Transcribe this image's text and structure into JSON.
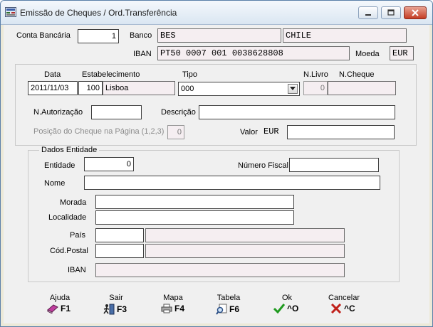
{
  "window": {
    "title": "Emissão de Cheques / Ord.Transferência"
  },
  "header": {
    "conta_label": "Conta Bancária",
    "conta_value": "1",
    "banco_label": "Banco",
    "banco_value": "BES",
    "pais_value": "CHILE",
    "iban_label": "IBAN",
    "iban_value": "PT50 0007  001 0038628808",
    "moeda_label": "Moeda",
    "moeda_value": "EUR"
  },
  "cheque": {
    "data_label": "Data",
    "data_value": "2011/11/03",
    "estab_label": "Estabelecimento",
    "estab_code": "100",
    "estab_name": "Lisboa",
    "tipo_label": "Tipo",
    "tipo_value": "000",
    "nlivro_label": "N.Livro",
    "nlivro_value": "0",
    "ncheque_label": "N.Cheque",
    "ncheque_value": "",
    "nautorizacao_label": "N.Autorização",
    "nautorizacao_value": "",
    "descricao_label": "Descrição",
    "descricao_value": "",
    "posicao_label": "Posição do Cheque na Página (1,2,3)",
    "posicao_value": "0",
    "valor_label": "Valor",
    "valor_currency": "EUR",
    "valor_value": ""
  },
  "entidade": {
    "group_title": "Dados Entidade",
    "entidade_label": "Entidade",
    "entidade_value": "0",
    "nif_label": "Número Fiscal",
    "nif_value": "",
    "nome_label": "Nome",
    "nome_value": "",
    "morada_label": "Morada",
    "morada_value": "",
    "localidade_label": "Localidade",
    "localidade_value": "",
    "pais_label": "País",
    "pais_code": "",
    "pais_name": "",
    "codpostal_label": "Cód.Postal",
    "codpostal_code": "",
    "codpostal_name": "",
    "iban_label": "IBAN",
    "iban_value": ""
  },
  "toolbar": [
    {
      "caption": "Ajuda",
      "key": "F1",
      "icon": "book-icon"
    },
    {
      "caption": "Sair",
      "key": "F3",
      "icon": "exit-icon"
    },
    {
      "caption": "Mapa",
      "key": "F4",
      "icon": "printer-icon"
    },
    {
      "caption": "Tabela",
      "key": "F6",
      "icon": "search-icon"
    },
    {
      "caption": "Ok",
      "key": "^O",
      "icon": "check-icon"
    },
    {
      "caption": "Cancelar",
      "key": "^C",
      "icon": "cross-icon"
    }
  ]
}
